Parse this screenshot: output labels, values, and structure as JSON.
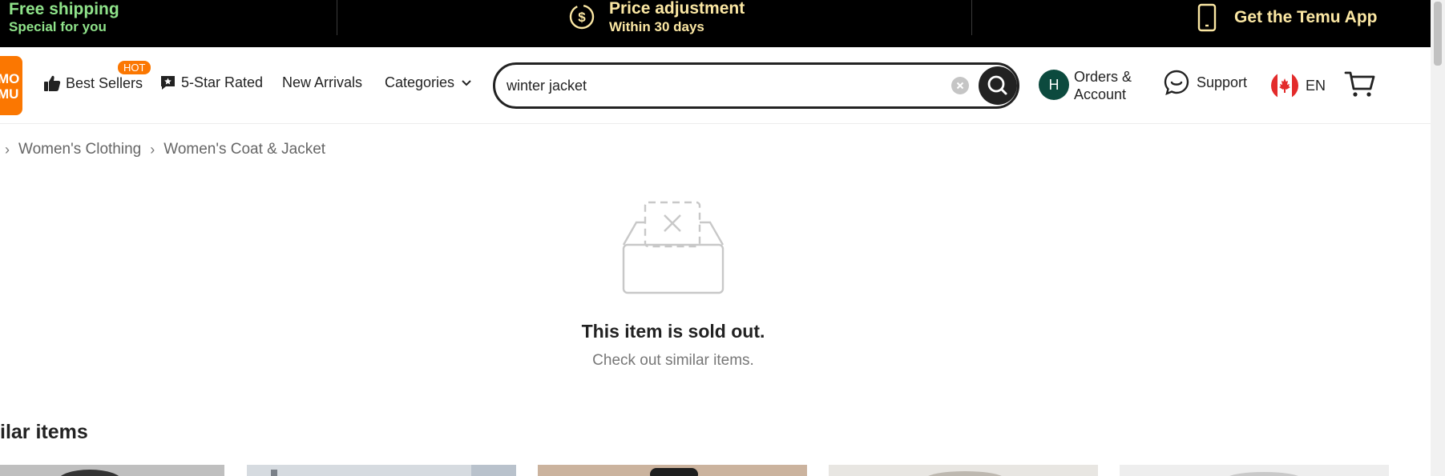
{
  "banner": {
    "shipping_title": "Free shipping",
    "shipping_sub": "Special for you",
    "price_title": "Price adjustment",
    "price_sub": "Within 30 days",
    "app_label": "Get the Temu App"
  },
  "logo": {
    "text_line1": "MO",
    "text_line2": "MU"
  },
  "nav": {
    "best_sellers": "Best Sellers",
    "hot_badge": "HOT",
    "five_star": "5-Star Rated",
    "new_arrivals": "New Arrivals",
    "categories": "Categories"
  },
  "search": {
    "value": "winter jacket"
  },
  "account": {
    "avatar_letter": "H",
    "label_line1": "Orders &",
    "label_line2": "Account",
    "support": "Support",
    "language": "EN"
  },
  "breadcrumb": [
    "Women's Clothing",
    "Women's Coat & Jacket"
  ],
  "empty_state": {
    "title": "This item is sold out.",
    "subtitle": "Check out similar items."
  },
  "similar": {
    "title": "ilar items"
  },
  "colors": {
    "banner_bg": "#000000",
    "shipping_green": "#8fe38a",
    "banner_yellow": "#fbe7a3",
    "brand_orange": "#fb7701",
    "avatar_green": "#0c4a3e"
  },
  "cards": [
    {
      "bg": "#bfbfbf"
    },
    {
      "bg": "#d6dbe0"
    },
    {
      "bg": "#cbb39e"
    },
    {
      "bg": "#e8e6e2"
    },
    {
      "bg": "#eeeeee"
    }
  ]
}
